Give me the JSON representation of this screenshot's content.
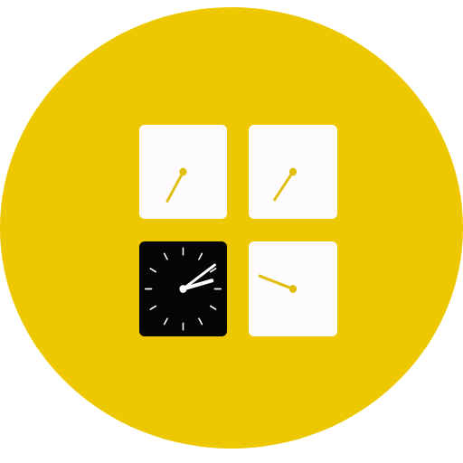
{
  "app_icon": {
    "icon": "clock-grid-icon",
    "colors": {
      "badge": "#EDC800",
      "tile_light": "#FEFBFE",
      "tile_dark": "#050505",
      "hand_on_light": "#E0BE10",
      "hand_on_dark": "#FFFFFF",
      "tick_on_dark": "#FFFFFF"
    },
    "tiles": [
      {
        "icon": "analog-clock-icon",
        "theme": "light",
        "hands": [
          {
            "angle": 210,
            "length": 0.36
          }
        ]
      },
      {
        "icon": "analog-clock-icon",
        "theme": "light",
        "hands": [
          {
            "angle": 215,
            "length": 0.36
          }
        ]
      },
      {
        "icon": "analog-clock-icon",
        "theme": "dark",
        "ticks": true,
        "hands": [
          {
            "angle": 75,
            "length": 0.34
          },
          {
            "angle": 55,
            "length": 0.44
          }
        ]
      },
      {
        "icon": "analog-clock-icon",
        "theme": "light",
        "hands": [
          {
            "angle": 290,
            "length": 0.4
          }
        ]
      }
    ]
  }
}
